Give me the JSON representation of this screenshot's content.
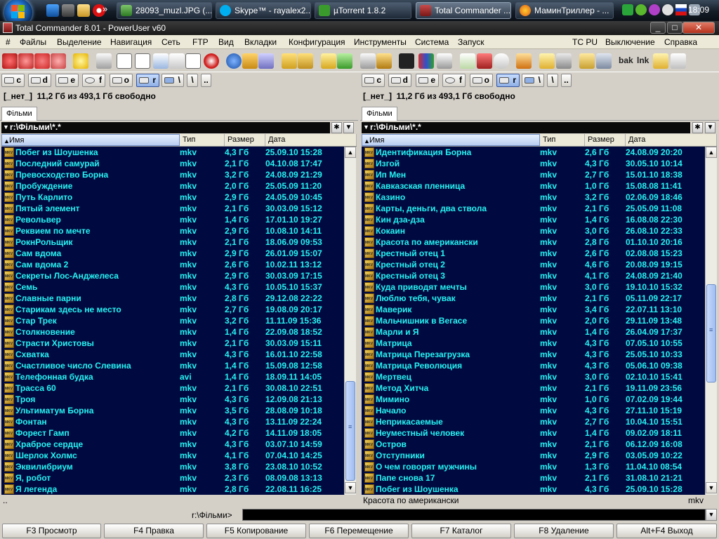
{
  "taskbar": {
    "quicklaunch_icons": [
      "ie-icon",
      "media-icon",
      "folder-icon",
      "opera-icon"
    ],
    "buttons": [
      {
        "label": "28093_muzl.JPG (...",
        "icon": "image-viewer-icon"
      },
      {
        "label": "Skype™ - rayalex2...",
        "icon": "skype-icon"
      },
      {
        "label": "µTorrent 1.8.2",
        "icon": "utorrent-icon"
      },
      {
        "label": "Total Commander ...",
        "icon": "total-commander-icon"
      },
      {
        "label": "МаминТриллер - ...",
        "icon": "firefox-icon"
      }
    ],
    "clock": "18:09"
  },
  "window": {
    "title": "Total Commander 8.01 - PowerUser v60",
    "min_label": "_",
    "max_label": "□",
    "close_label": "✕"
  },
  "menu": {
    "items": [
      "#",
      "Файлы",
      "Выделение",
      "Навигация",
      "Сеть",
      "FTP",
      "Вид",
      "Вкладки",
      "Конфигурация",
      "Инструменты",
      "Система",
      "Запуск"
    ],
    "right_items": [
      "TC PU",
      "Выключение",
      "Справка"
    ]
  },
  "toolbar": {
    "text_buttons": [
      "bak",
      "lnk"
    ]
  },
  "drives": [
    "c",
    "d",
    "e",
    "f",
    "o",
    "r"
  ],
  "left_panel": {
    "drive_label": "[_нет_]",
    "free_space": "11,2 Гб из 493,1 Гб свободно",
    "tab": "Фільми",
    "path": "r:\\Фільми\\*.*",
    "columns": {
      "name": "Имя",
      "type": "Тип",
      "size": "Размер",
      "date": "Дата"
    },
    "files": [
      [
        "Побег из Шоушенка",
        "mkv",
        "4,3 Гб",
        "25.09.10 15:28"
      ],
      [
        "Последний самурай",
        "mkv",
        "2,1 Гб",
        "04.10.08 17:47"
      ],
      [
        "Превосходство Борна",
        "mkv",
        "3,2 Гб",
        "24.08.09 21:29"
      ],
      [
        "Пробуждение",
        "mkv",
        "2,0 Гб",
        "25.05.09 11:20"
      ],
      [
        "Путь Карлито",
        "mkv",
        "2,9 Гб",
        "24.05.09 10:45"
      ],
      [
        "Пятый элемент",
        "mkv",
        "2,1 Гб",
        "30.03.09 15:12"
      ],
      [
        "Револьвер",
        "mkv",
        "1,4 Гб",
        "17.01.10 19:27"
      ],
      [
        "Реквием по мечте",
        "mkv",
        "2,9 Гб",
        "10.08.10 14:11"
      ],
      [
        "РокнРольщик",
        "mkv",
        "2,1 Гб",
        "18.06.09 09:53"
      ],
      [
        "Сам вдома",
        "mkv",
        "2,9 Гб",
        "26.01.09 15:07"
      ],
      [
        "Сам вдома 2",
        "mkv",
        "2,6 Гб",
        "10.02.11 13:12"
      ],
      [
        "Секреты Лос-Анджелеса",
        "mkv",
        "2,9 Гб",
        "30.03.09 17:15"
      ],
      [
        "Семь",
        "mkv",
        "4,3 Гб",
        "10.05.10 15:37"
      ],
      [
        "Славные парни",
        "mkv",
        "2,8 Гб",
        "29.12.08 22:22"
      ],
      [
        "Старикам здесь не место",
        "mkv",
        "2,7 Гб",
        "19.08.09 20:17"
      ],
      [
        "Стар Трек",
        "mkv",
        "3,2 Гб",
        "11.11.09 15:36"
      ],
      [
        "Столкновение",
        "mkv",
        "1,4 Гб",
        "22.09.08 18:52"
      ],
      [
        "Страсти Христовы",
        "mkv",
        "2,1 Гб",
        "30.03.09 15:11"
      ],
      [
        "Схватка",
        "mkv",
        "4,3 Гб",
        "16.01.10 22:58"
      ],
      [
        "Счастливое число Слевина",
        "mkv",
        "1,4 Гб",
        "15.09.08 12:58"
      ],
      [
        "Телефонная будка",
        "avi",
        "1,4 Гб",
        "18.09.11 14:05"
      ],
      [
        "Трасса 60",
        "mkv",
        "2,1 Гб",
        "30.08.10 22:51"
      ],
      [
        "Троя",
        "mkv",
        "4,3 Гб",
        "12.09.08 21:13"
      ],
      [
        "Ультиматум Борна",
        "mkv",
        "3,5 Гб",
        "28.08.09 10:18"
      ],
      [
        "Фонтан",
        "mkv",
        "4,3 Гб",
        "13.11.09 22:24"
      ],
      [
        "Форест Гамп",
        "mkv",
        "4,2 Гб",
        "14.11.09 18:05"
      ],
      [
        "Храброе сердце",
        "mkv",
        "4,3 Гб",
        "03.07.10 14:59"
      ],
      [
        "Шерлок Холмс",
        "mkv",
        "4,1 Гб",
        "07.04.10 14:25"
      ],
      [
        "Эквилибриум",
        "mkv",
        "3,8 Гб",
        "23.08.10 10:52"
      ],
      [
        "Я, робот",
        "mkv",
        "2,3 Гб",
        "08.09.08 13:13"
      ],
      [
        "Я легенда",
        "mkv",
        "2,8 Гб",
        "22.08.11 16:25"
      ]
    ],
    "status": ".."
  },
  "right_panel": {
    "drive_label": "[_нет_]",
    "free_space": "11,2 Гб из 493,1 Гб свободно",
    "tab": "Фільми",
    "path": "r:\\Фільми\\*.*",
    "columns": {
      "name": "Имя",
      "type": "Тип",
      "size": "Размер",
      "date": "Дата"
    },
    "files": [
      [
        "Идентификация Борна",
        "mkv",
        "2,6 Гб",
        "24.08.09 20:20"
      ],
      [
        "Изгой",
        "mkv",
        "4,3 Гб",
        "30.05.10 10:14"
      ],
      [
        "Ип Мен",
        "mkv",
        "2,7 Гб",
        "15.01.10 18:38"
      ],
      [
        "Кавказская пленница",
        "mkv",
        "1,0 Гб",
        "15.08.08 11:41"
      ],
      [
        "Казино",
        "mkv",
        "3,2 Гб",
        "02.06.09 18:46"
      ],
      [
        "Карты, деньги,  два ствола",
        "mkv",
        "2,1 Гб",
        "25.05.09 11:08"
      ],
      [
        "Кин дза-дза",
        "mkv",
        "1,4 Гб",
        "16.08.08 22:30"
      ],
      [
        "Кокаин",
        "mkv",
        "3,0 Гб",
        "26.08.10 22:33"
      ],
      [
        "Красота по американски",
        "mkv",
        "2,8 Гб",
        "01.10.10 20:16"
      ],
      [
        "Крестный отец 1",
        "mkv",
        "2,6 Гб",
        "02.08.08 15:23"
      ],
      [
        "Крестный отец 2",
        "mkv",
        "4,6 Гб",
        "20.08.09 19:15"
      ],
      [
        "Крестный отец 3",
        "mkv",
        "4,1 Гб",
        "24.08.09 21:40"
      ],
      [
        "Куда приводят мечты",
        "mkv",
        "3,0 Гб",
        "19.10.10 15:32"
      ],
      [
        "Люблю тебя, чувак",
        "mkv",
        "2,1 Гб",
        "05.11.09 22:17"
      ],
      [
        "Маверик",
        "mkv",
        "3,4 Гб",
        "22.07.11 13:10"
      ],
      [
        "Мальчишник в Вегасе",
        "mkv",
        "2,0 Гб",
        "29.11.09 13:48"
      ],
      [
        "Марли и Я",
        "mkv",
        "1,4 Гб",
        "26.04.09 17:37"
      ],
      [
        "Матрица",
        "mkv",
        "4,3 Гб",
        "07.05.10 10:55"
      ],
      [
        "Матрица Перезагрузка",
        "mkv",
        "4,3 Гб",
        "25.05.10 10:33"
      ],
      [
        "Матрица Революция",
        "mkv",
        "4,3 Гб",
        "05.06.10 09:38"
      ],
      [
        "Мертвец",
        "mkv",
        "3,0 Гб",
        "02.10.10 15:41"
      ],
      [
        "Метод Хитча",
        "mkv",
        "2,1 Гб",
        "19.11.09 23:56"
      ],
      [
        "Мимино",
        "mkv",
        "1,0 Гб",
        "07.02.09 19:44"
      ],
      [
        "Начало",
        "mkv",
        "4,3 Гб",
        "27.11.10 15:19"
      ],
      [
        "Неприкасаемые",
        "mkv",
        "2,7 Гб",
        "10.04.10 15:51"
      ],
      [
        "Неуместный человек",
        "mkv",
        "1,4 Гб",
        "09.02.09 18:11"
      ],
      [
        "Остров",
        "mkv",
        "2,1 Гб",
        "06.12.09 16:08"
      ],
      [
        "Отступники",
        "mkv",
        "2,9 Гб",
        "03.05.09 10:22"
      ],
      [
        "О чем говорят мужчины",
        "mkv",
        "1,3 Гб",
        "11.04.10 08:54"
      ],
      [
        "Папе снова 17",
        "mkv",
        "2,1 Гб",
        "31.08.10 21:21"
      ],
      [
        "Побег из Шоушенка",
        "mkv",
        "4,3 Гб",
        "25.09.10 15:28"
      ]
    ],
    "status_name": "Красота по американски",
    "status_ext": "mkv"
  },
  "command": {
    "label": "r:\\Фільми>",
    "value": ""
  },
  "fkeys": [
    "F3 Просмотр",
    "F4 Правка",
    "F5 Копирование",
    "F6 Перемещение",
    "F7 Каталог",
    "F8 Удаление",
    "Alt+F4 Выход"
  ],
  "colors": {
    "panel_bg": "#000a40",
    "file_text": "#26f3f3",
    "chrome": "#d4d0c8"
  }
}
